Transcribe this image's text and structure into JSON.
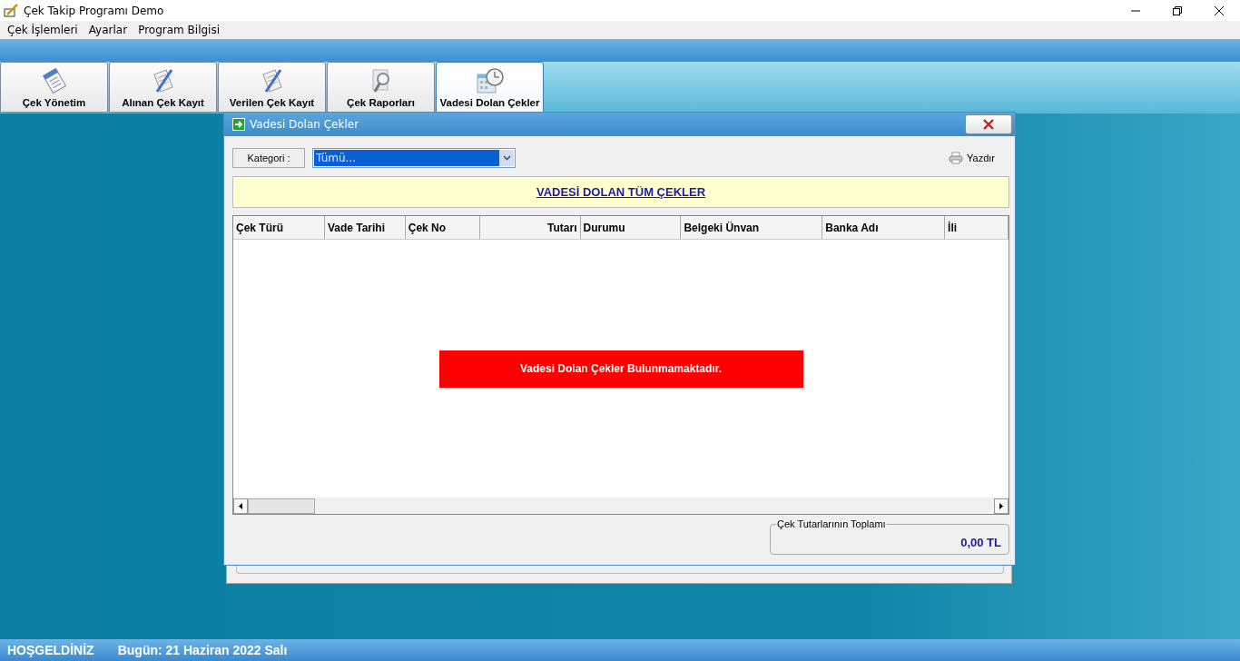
{
  "window": {
    "title": "Çek Takip Programı Demo"
  },
  "menu": [
    "Çek İşlemleri",
    "Ayarlar",
    "Program Bilgisi"
  ],
  "toolbar": [
    {
      "label": "Çek Yönetim",
      "selected": false
    },
    {
      "label": "Alınan Çek Kayıt",
      "selected": false
    },
    {
      "label": "Verilen Çek Kayıt",
      "selected": false
    },
    {
      "label": "Çek Raporları",
      "selected": false
    },
    {
      "label": "Vadesi Dolan Çekler",
      "selected": true
    }
  ],
  "dialog": {
    "title": "Vadesi Dolan Çekler",
    "category_label": "Kategori :",
    "category_value": "Tümü...",
    "print": "Yazdır",
    "heading": "VADESİ DOLAN TÜM ÇEKLER",
    "columns": [
      "Çek Türü",
      "Vade Tarihi",
      "Çek No",
      "Tutarı",
      "Durumu",
      "Belgeki Ünvan",
      "Banka Adı",
      "İli"
    ],
    "empty_message": "Vadesi Dolan Çekler Bulunmamaktadır.",
    "total_label": "Çek Tutarlarının Toplamı",
    "total_value": "0,00 TL"
  },
  "status_bar": {
    "welcome": "HOŞGELDİNİZ",
    "date": "Bugün: 21 Haziran 2022 Salı"
  }
}
